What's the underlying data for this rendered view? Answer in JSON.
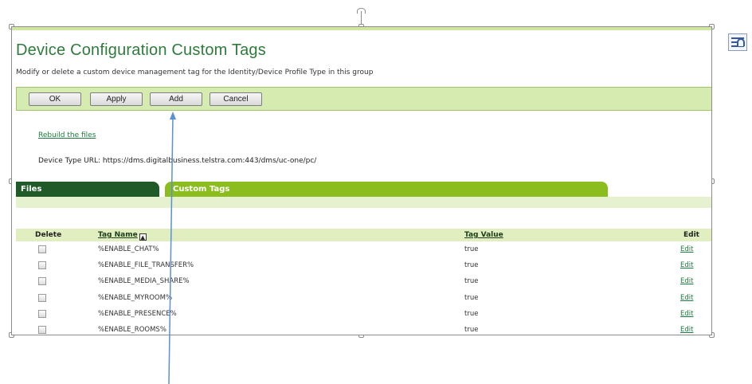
{
  "page": {
    "title": "Device Configuration Custom Tags",
    "subtitle": "Modify or delete a custom device management tag for the Identity/Device Profile Type in this group"
  },
  "toolbar": {
    "ok_label": "OK",
    "apply_label": "Apply",
    "add_label": "Add",
    "cancel_label": "Cancel"
  },
  "links": {
    "rebuild": "Rebuild the files"
  },
  "device_type_url": "Device Type URL: https://dms.digitalbusiness.telstra.com:443/dms/uc-one/pc/",
  "tabs": {
    "files": "Files",
    "custom_tags": "Custom Tags"
  },
  "table": {
    "headers": {
      "delete": "Delete",
      "tag_name": "Tag Name",
      "tag_value": "Tag Value",
      "edit": "Edit"
    },
    "rows": [
      {
        "tag": "%ENABLE_CHAT%",
        "value": "true",
        "edit": "Edit"
      },
      {
        "tag": "%ENABLE_FILE_TRANSFER%",
        "value": "true",
        "edit": "Edit"
      },
      {
        "tag": "%ENABLE_MEDIA_SHARE%",
        "value": "true",
        "edit": "Edit"
      },
      {
        "tag": "%ENABLE_MYROOM%",
        "value": "true",
        "edit": "Edit"
      },
      {
        "tag": "%ENABLE_PRESENCE%",
        "value": "true",
        "edit": "Edit"
      },
      {
        "tag": "%ENABLE_ROOMS%",
        "value": "true",
        "edit": "Edit"
      }
    ]
  },
  "colors": {
    "title_green": "#2f7b3c",
    "toolbar_bg": "#d6ebb0",
    "tab_files": "#1f5a28",
    "tab_custom": "#8cbd1e",
    "arrow": "#5b8fd6"
  }
}
